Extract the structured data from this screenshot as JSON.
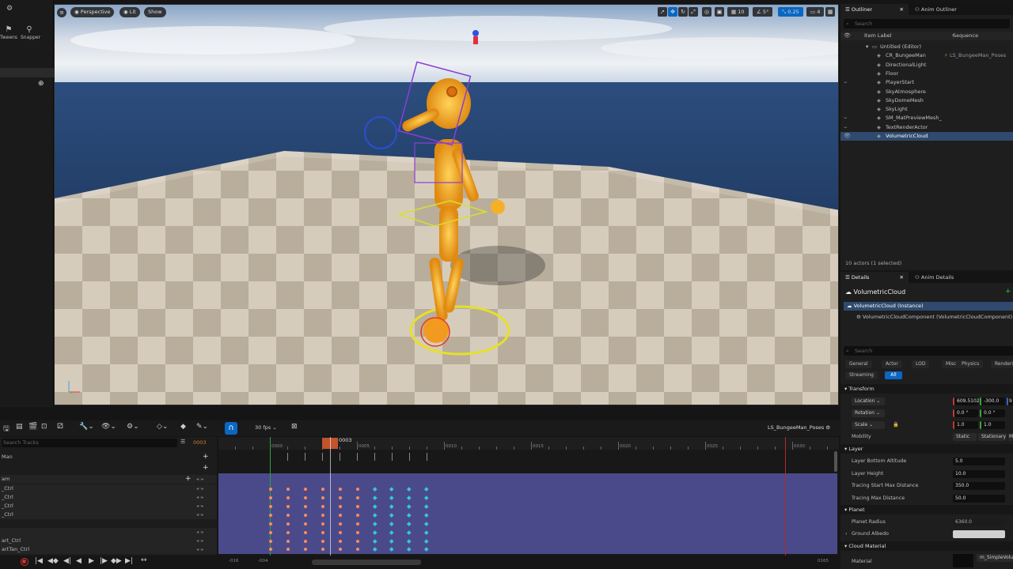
{
  "left_toolbar": {
    "modes": [
      {
        "icon": "selection-mode-icon",
        "label": ""
      },
      {
        "icon": "tweens-icon",
        "label": "Tweens"
      },
      {
        "icon": "snapper-icon",
        "label": "Snapper"
      }
    ]
  },
  "viewport": {
    "menu_icon": "hamburger-icon",
    "view_mode": "Perspective",
    "lit_mode": "Lit",
    "show_label": "Show",
    "grid_snap": "10",
    "rotation_snap": "5°",
    "camera_speed": "0.25",
    "screen_percentage": "4"
  },
  "outliner": {
    "tabs": [
      "Outliner",
      "Anim Outliner"
    ],
    "search_placeholder": "Search",
    "columns": {
      "label": "Item Label",
      "sequence": "Sequence"
    },
    "items": [
      {
        "label": "Untitled (Editor)",
        "sequence": "",
        "eye": false,
        "selected": false,
        "indent": 1
      },
      {
        "label": "CR_BungeeMan",
        "sequence": "LS_BungeeMan_Poses",
        "eye": false,
        "selected": false,
        "indent": 2
      },
      {
        "label": "DirectionalLight",
        "sequence": "",
        "eye": false,
        "selected": false,
        "indent": 2
      },
      {
        "label": "Floor",
        "sequence": "",
        "eye": false,
        "selected": false,
        "indent": 2
      },
      {
        "label": "PlayerStart",
        "sequence": "",
        "eye": true,
        "selected": false,
        "indent": 2
      },
      {
        "label": "SkyAtmosphere",
        "sequence": "",
        "eye": false,
        "selected": false,
        "indent": 2
      },
      {
        "label": "SkyDomeMesh",
        "sequence": "",
        "eye": false,
        "selected": false,
        "indent": 2
      },
      {
        "label": "SkyLight",
        "sequence": "",
        "eye": false,
        "selected": false,
        "indent": 2
      },
      {
        "label": "SM_MatPreviewMesh_",
        "sequence": "",
        "eye": true,
        "selected": false,
        "indent": 2
      },
      {
        "label": "TextRenderActor",
        "sequence": "",
        "eye": true,
        "selected": false,
        "indent": 2
      },
      {
        "label": "VolumetricCloud",
        "sequence": "",
        "eye": true,
        "selected": true,
        "indent": 2
      }
    ],
    "footer": "10 actors (1 selected)"
  },
  "details": {
    "tabs": [
      "Details",
      "Anim Details"
    ],
    "actor_name": "VolumetricCloud",
    "instance_label": "VolumetricCloud (Instance)",
    "component_label": "VolumetricCloudComponent (VolumetricCloudComponent)",
    "search_placeholder": "Search",
    "filters": [
      "General",
      "Actor",
      "LOD",
      "Misc",
      "Physics",
      "Rendering",
      "Streaming",
      "All"
    ],
    "active_filter": "All",
    "transform": {
      "header": "Transform",
      "location_label": "Location",
      "location": [
        "609.5102",
        "-300.0",
        "9"
      ],
      "rotation_label": "Rotation",
      "rotation": [
        "0.0 °",
        "0.0 °"
      ],
      "scale_label": "Scale",
      "scale": [
        "1.0",
        "1.0"
      ],
      "mobility_label": "Mobility",
      "mobility_options": [
        "Static",
        "Stationary",
        "M"
      ]
    },
    "layer": {
      "header": "Layer",
      "props": [
        {
          "label": "Layer Bottom Altitude",
          "value": "5.0"
        },
        {
          "label": "Layer Height",
          "value": "10.0"
        },
        {
          "label": "Tracing Start Max Distance",
          "value": "350.0"
        },
        {
          "label": "Tracing Max Distance",
          "value": "50.0"
        }
      ]
    },
    "planet": {
      "header": "Planet",
      "radius_label": "Planet Radius",
      "radius_value": "6360.0",
      "albedo_label": "Ground Albedo"
    },
    "cloud_material": {
      "header": "Cloud Material",
      "material_label": "Material",
      "material_value": "m_SimpleVolu"
    }
  },
  "sequencer": {
    "fps": "30 fps",
    "sequence_name": "LS_BungeeMan_Poses",
    "current_frame": "0003",
    "frame_field": "0003",
    "search_placeholder": "Search Tracks",
    "track_labels": [
      "Man",
      "",
      "am",
      "_Ctrl",
      "_Ctrl",
      "_Ctrl",
      "_Ctrl",
      "",
      "art_Ctrl",
      "artTan_Ctrl"
    ],
    "ruler_labels": [
      "0000",
      "0005",
      "0010",
      "0015",
      "0020",
      "0025",
      "0030"
    ],
    "range_start": "-016",
    "range_view_start": "-004",
    "range_end": "0165"
  },
  "colors": {
    "accent": "#0a67c2",
    "playhead": "#c1542c",
    "section": "#4a4a8a",
    "key_orange": "#ff8a5c",
    "key_cyan": "#34c8d8"
  }
}
